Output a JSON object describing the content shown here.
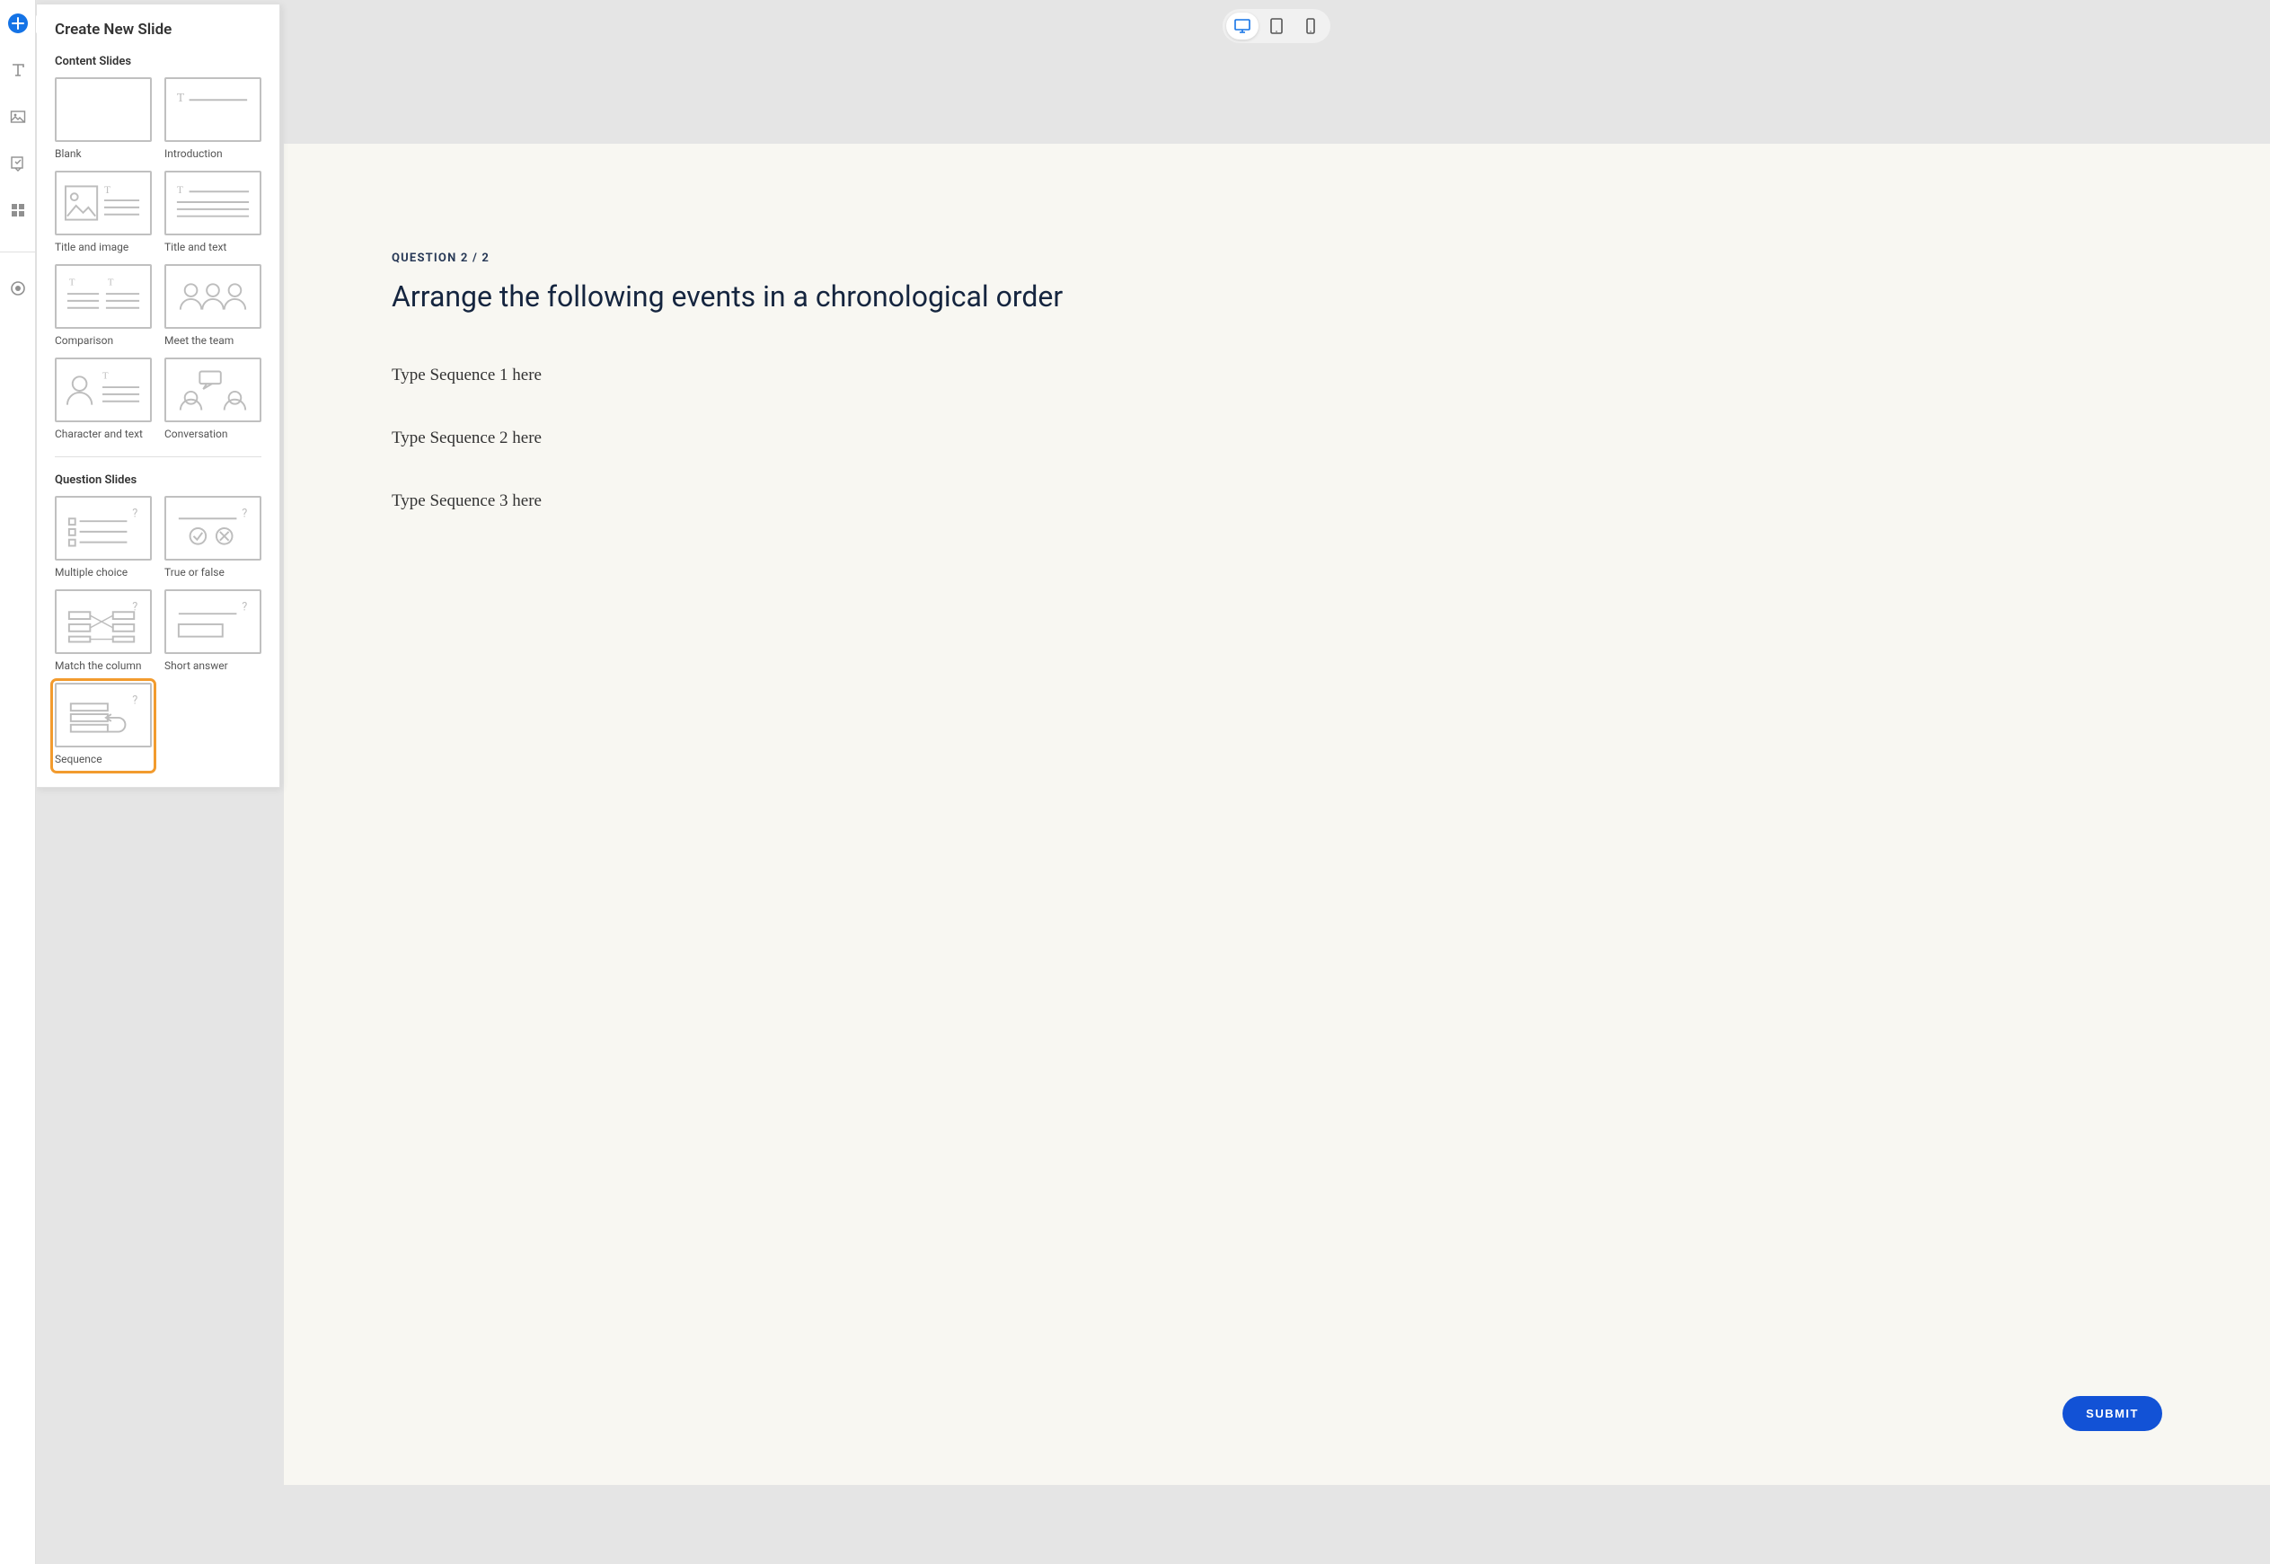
{
  "rail": {
    "add_icon": "plus-circle",
    "tools": [
      "text",
      "media",
      "question",
      "grid",
      "record"
    ]
  },
  "flyout": {
    "title": "Create New Slide",
    "sections": {
      "content": {
        "label": "Content Slides",
        "items": [
          {
            "id": "blank",
            "label": "Blank"
          },
          {
            "id": "introduction",
            "label": "Introduction"
          },
          {
            "id": "title-image",
            "label": "Title and image"
          },
          {
            "id": "title-text",
            "label": "Title and text"
          },
          {
            "id": "comparison",
            "label": "Comparison"
          },
          {
            "id": "meet-team",
            "label": "Meet the team"
          },
          {
            "id": "character-text",
            "label": "Character and text"
          },
          {
            "id": "conversation",
            "label": "Conversation"
          }
        ]
      },
      "question": {
        "label": "Question Slides",
        "items": [
          {
            "id": "multiple-choice",
            "label": "Multiple choice"
          },
          {
            "id": "true-false",
            "label": "True or false"
          },
          {
            "id": "match-column",
            "label": "Match the column"
          },
          {
            "id": "short-answer",
            "label": "Short answer"
          },
          {
            "id": "sequence",
            "label": "Sequence",
            "selected": true
          }
        ]
      }
    }
  },
  "device_switcher": {
    "options": [
      "desktop",
      "tablet",
      "mobile"
    ],
    "active": "desktop"
  },
  "slide": {
    "counter": "QUESTION 2 / 2",
    "title": "Arrange the following events in a chronological order",
    "sequence_items": [
      "Type Sequence 1 here",
      "Type Sequence 2 here",
      "Type Sequence 3 here"
    ],
    "submit_label": "SUBMIT"
  }
}
